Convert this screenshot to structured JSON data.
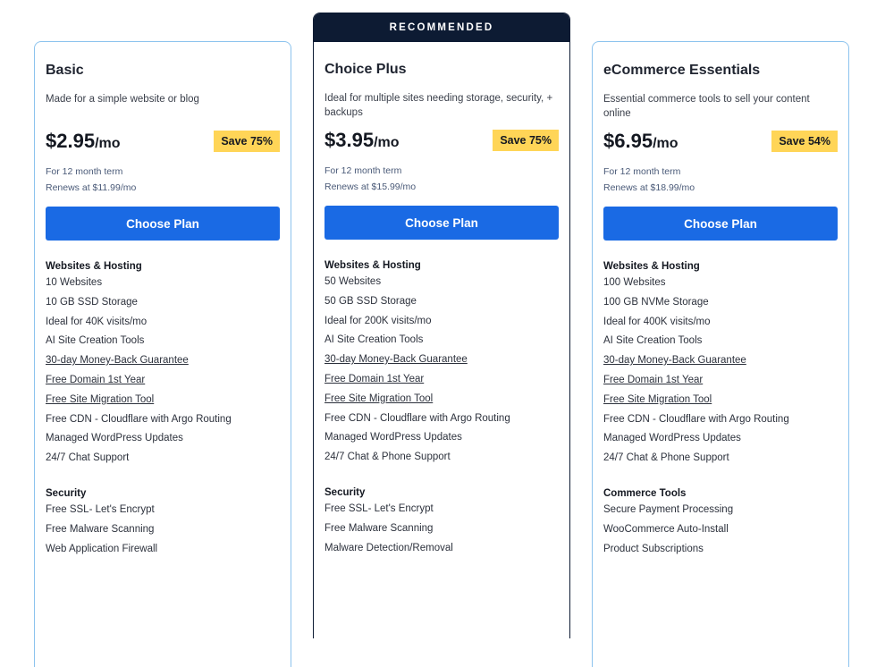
{
  "recommended_label": "RECOMMENDED",
  "plans": [
    {
      "name": "Basic",
      "description": "Made for a simple website or blog",
      "price": "$2.95",
      "per": "/mo",
      "save": "Save 75%",
      "term": "For 12 month term",
      "renews": "Renews at $11.99/mo",
      "cta": "Choose Plan",
      "section1_title": "Websites & Hosting",
      "section1": [
        "10 Websites",
        "10 GB SSD Storage",
        "Ideal for 40K visits/mo",
        "AI Site Creation Tools",
        "30-day Money-Back Guarantee",
        "Free Domain 1st Year",
        "Free Site Migration Tool",
        "Free CDN - Cloudflare with Argo Routing",
        "Managed WordPress Updates",
        "24/7 Chat Support"
      ],
      "section2_title": "Security",
      "section2": [
        "Free SSL- Let's Encrypt",
        "Free Malware Scanning",
        "Web Application Firewall"
      ]
    },
    {
      "name": "Choice Plus",
      "description": "Ideal for multiple sites needing storage, security, + backups",
      "price": "$3.95",
      "per": "/mo",
      "save": "Save 75%",
      "term": "For 12 month term",
      "renews": "Renews at $15.99/mo",
      "cta": "Choose Plan",
      "section1_title": "Websites & Hosting",
      "section1": [
        "50 Websites",
        "50 GB SSD Storage",
        "Ideal for 200K visits/mo",
        "AI Site Creation Tools",
        "30-day Money-Back Guarantee",
        "Free Domain 1st Year",
        "Free Site Migration Tool",
        "Free CDN - Cloudflare with Argo Routing",
        "Managed WordPress Updates",
        "24/7 Chat & Phone Support"
      ],
      "section2_title": "Security",
      "section2": [
        "Free SSL- Let's Encrypt",
        "Free Malware Scanning",
        "Malware Detection/Removal"
      ]
    },
    {
      "name": "eCommerce Essentials",
      "description": "Essential commerce tools to sell your content online",
      "price": "$6.95",
      "per": "/mo",
      "save": "Save 54%",
      "term": "For 12 month term",
      "renews": "Renews at $18.99/mo",
      "cta": "Choose Plan",
      "section1_title": "Websites & Hosting",
      "section1": [
        "100 Websites",
        "100 GB NVMe Storage",
        "Ideal for 400K visits/mo",
        "AI Site Creation Tools",
        "30-day Money-Back Guarantee",
        "Free Domain 1st Year",
        "Free Site Migration Tool",
        "Free CDN - Cloudflare with Argo Routing",
        "Managed WordPress Updates",
        "24/7 Chat & Phone Support"
      ],
      "section2_title": "Commerce Tools",
      "section2": [
        "Secure Payment Processing",
        "WooCommerce Auto-Install",
        "Product Subscriptions"
      ]
    }
  ],
  "colors": {
    "card_border": "#8cc3ee",
    "recommended_bg": "#0d1b33",
    "cta_bg": "#1a6ae4",
    "save_badge_bg": "#ffd557"
  }
}
